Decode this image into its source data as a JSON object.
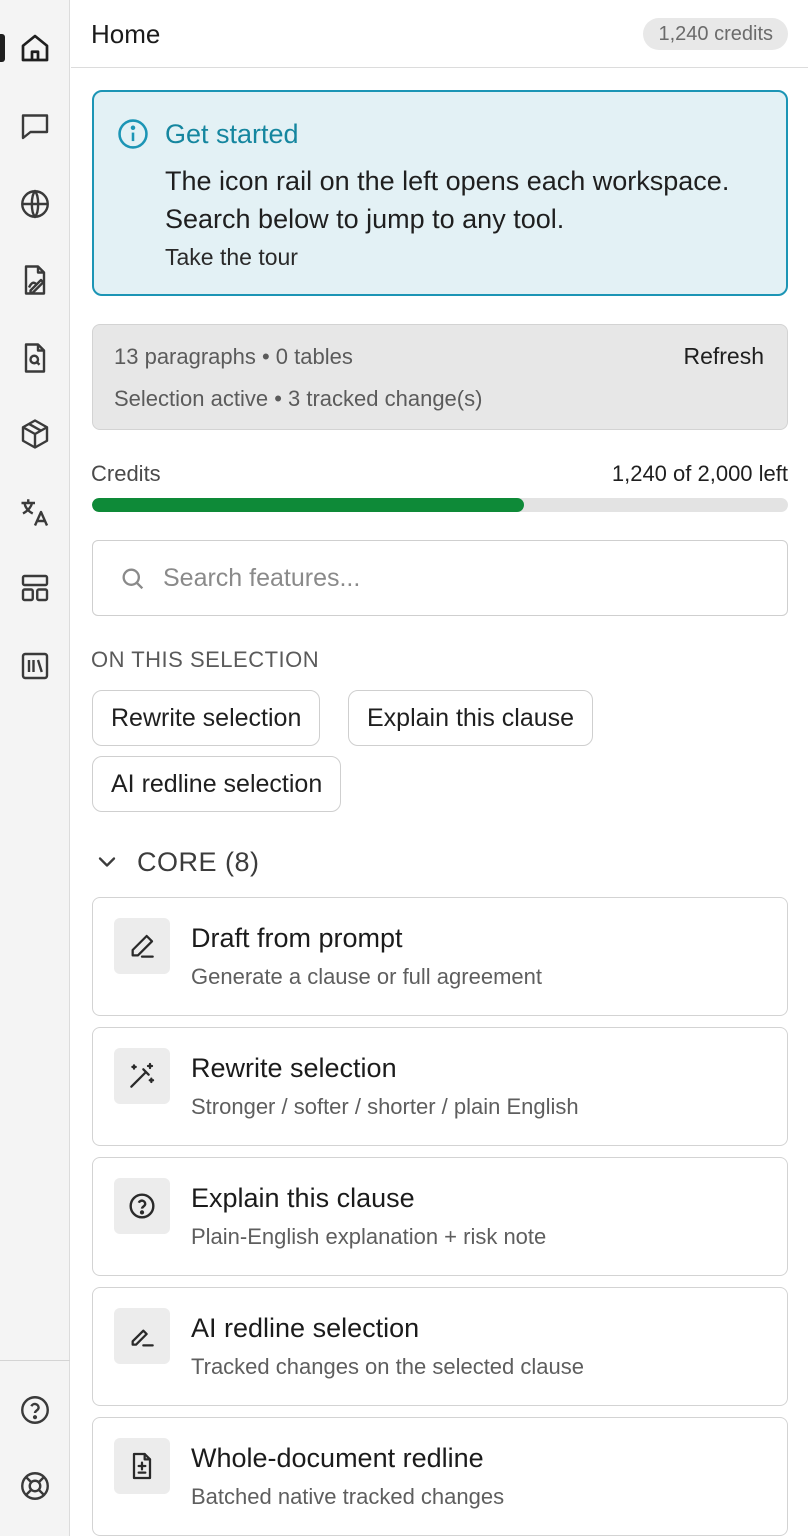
{
  "header": {
    "title": "Home",
    "credits_badge": "1,240 credits"
  },
  "rail": {
    "items": [
      {
        "icon": "home-icon",
        "active": true
      },
      {
        "icon": "chat-icon",
        "active": false
      },
      {
        "icon": "globe-icon",
        "active": false
      },
      {
        "icon": "file-signature-icon",
        "active": false
      },
      {
        "icon": "file-search-icon",
        "active": false
      },
      {
        "icon": "package-icon",
        "active": false
      },
      {
        "icon": "translate-icon",
        "active": false
      },
      {
        "icon": "layout-icon",
        "active": false
      },
      {
        "icon": "library-icon",
        "active": false
      }
    ],
    "bottom_items": [
      {
        "icon": "help-icon"
      },
      {
        "icon": "lifebuoy-icon"
      }
    ]
  },
  "banner": {
    "title": "Get started",
    "body": "The icon rail on the left opens each workspace. Search below to jump to any tool.",
    "link": "Take the tour",
    "accent_color": "#1c95b5"
  },
  "doc_status": {
    "stats": "13 paragraphs • 0 tables",
    "selection": "Selection active • 3 tracked change(s)",
    "refresh_label": "Refresh"
  },
  "credits": {
    "label": "Credits",
    "value_text": "1,240 of 2,000 left",
    "remaining": 1240,
    "total": 2000,
    "bar_color": "#0e8a38"
  },
  "search": {
    "placeholder": "Search features...",
    "value": ""
  },
  "selection_section": {
    "label": "ON THIS SELECTION",
    "chips": [
      "Rewrite selection",
      "Explain this clause",
      "AI redline selection"
    ]
  },
  "core_group": {
    "title": "CORE (8)",
    "expanded": true,
    "cards": [
      {
        "icon": "pencil-icon",
        "title": "Draft from prompt",
        "desc": "Generate a clause or full agreement"
      },
      {
        "icon": "magic-wand-icon",
        "title": "Rewrite selection",
        "desc": "Stronger / softer / shorter / plain English"
      },
      {
        "icon": "question-circle-icon",
        "title": "Explain this clause",
        "desc": "Plain-English explanation + risk note"
      },
      {
        "icon": "signature-icon",
        "title": "AI redline selection",
        "desc": "Tracked changes on the selected clause"
      },
      {
        "icon": "file-diff-icon",
        "title": "Whole-document redline",
        "desc": "Batched native tracked changes"
      }
    ]
  }
}
